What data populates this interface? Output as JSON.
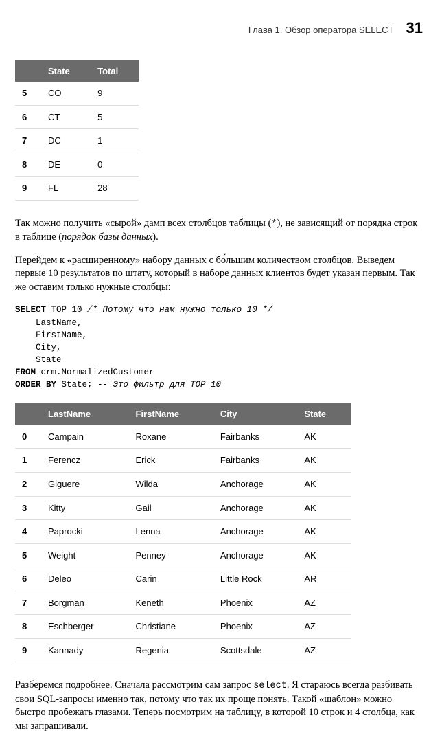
{
  "header": {
    "chapter": "Глава 1. Обзор оператора SELECT",
    "page": "31"
  },
  "table1": {
    "headers": [
      "",
      "State",
      "Total"
    ],
    "rows": [
      [
        "5",
        "CO",
        "9"
      ],
      [
        "6",
        "CT",
        "5"
      ],
      [
        "7",
        "DC",
        "1"
      ],
      [
        "8",
        "DE",
        "0"
      ],
      [
        "9",
        "FL",
        "28"
      ]
    ]
  },
  "para1_a": "Так можно получить «сырой» дамп всех столбцов таблицы (",
  "para1_b": "*",
  "para1_c": "), не зависящий от порядка строк в таблице (",
  "para1_d": "порядок базы данных",
  "para1_e": ").",
  "para2": "Перейдем к «расширенному» набору данных с бо́льшим количеством столбцов. Выведем первые 10 результатов по штату, который в наборе данных клиентов будет указан первым. Так же оставим только нужные столбцы:",
  "code": {
    "l1a": "SELECT",
    "l1b": " TOP 10 ",
    "l1c": "/* Потому что нам нужно только 10 */",
    "l2": "    LastName,",
    "l3": "    FirstName,",
    "l4": "    City,",
    "l5": "    State",
    "l6a": "FROM",
    "l6b": " crm.NormalizedCustomer",
    "l7a": "ORDER BY",
    "l7b": " State; ",
    "l7c": "-- Это фильтр для TOP 10"
  },
  "table2": {
    "headers": [
      "",
      "LastName",
      "FirstName",
      "City",
      "State"
    ],
    "rows": [
      [
        "0",
        "Campain",
        "Roxane",
        "Fairbanks",
        "AK"
      ],
      [
        "1",
        "Ferencz",
        "Erick",
        "Fairbanks",
        "AK"
      ],
      [
        "2",
        "Giguere",
        "Wilda",
        "Anchorage",
        "AK"
      ],
      [
        "3",
        "Kitty",
        "Gail",
        "Anchorage",
        "AK"
      ],
      [
        "4",
        "Paprocki",
        "Lenna",
        "Anchorage",
        "AK"
      ],
      [
        "5",
        "Weight",
        "Penney",
        "Anchorage",
        "AK"
      ],
      [
        "6",
        "Deleo",
        "Carin",
        "Little Rock",
        "AR"
      ],
      [
        "7",
        "Borgman",
        "Keneth",
        "Phoenix",
        "AZ"
      ],
      [
        "8",
        "Eschberger",
        "Christiane",
        "Phoenix",
        "AZ"
      ],
      [
        "9",
        "Kannady",
        "Regenia",
        "Scottsdale",
        "AZ"
      ]
    ]
  },
  "para3_a": "Разберемся подробнее. Сначала рассмотрим сам запрос ",
  "para3_b": "select",
  "para3_c": ". Я стараюсь всегда разбивать свои SQL-запросы именно так, потому что так их проще понять. Такой «шаблон» можно быстро пробежать глазами. Теперь посмотрим на таблицу, в которой 10 строк и 4 столбца, как мы запрашивали."
}
